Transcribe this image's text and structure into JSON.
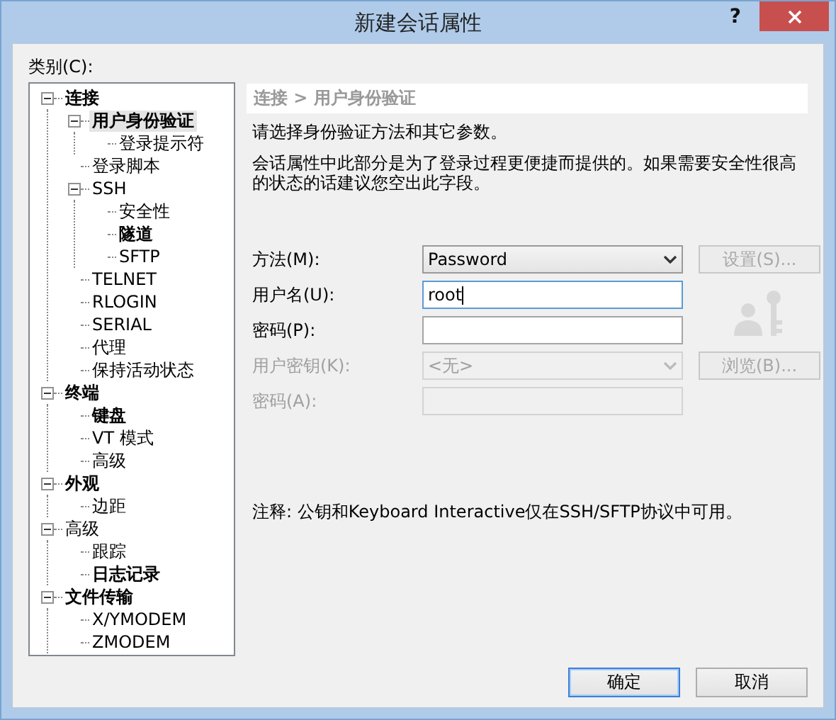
{
  "window": {
    "title": "新建会话属性",
    "help": "?"
  },
  "category_label": "类别(C):",
  "tree": [
    {
      "label": "连接",
      "bold": true,
      "selected": false,
      "expanded": true,
      "children": [
        {
          "label": "用户身份验证",
          "bold": true,
          "selected": true,
          "expanded": true,
          "children": [
            {
              "label": "登录提示符",
              "bold": false,
              "selected": false
            }
          ]
        },
        {
          "label": "登录脚本",
          "bold": false,
          "selected": false
        },
        {
          "label": "SSH",
          "bold": false,
          "selected": false,
          "expanded": true,
          "children": [
            {
              "label": "安全性",
              "bold": false,
              "selected": false
            },
            {
              "label": "隧道",
              "bold": true,
              "selected": false
            },
            {
              "label": "SFTP",
              "bold": false,
              "selected": false
            }
          ]
        },
        {
          "label": "TELNET",
          "bold": false,
          "selected": false
        },
        {
          "label": "RLOGIN",
          "bold": false,
          "selected": false
        },
        {
          "label": "SERIAL",
          "bold": false,
          "selected": false
        },
        {
          "label": "代理",
          "bold": false,
          "selected": false
        },
        {
          "label": "保持活动状态",
          "bold": false,
          "selected": false
        }
      ]
    },
    {
      "label": "终端",
      "bold": true,
      "selected": false,
      "expanded": true,
      "children": [
        {
          "label": "键盘",
          "bold": true,
          "selected": false
        },
        {
          "label": "VT 模式",
          "bold": false,
          "selected": false
        },
        {
          "label": "高级",
          "bold": false,
          "selected": false
        }
      ]
    },
    {
      "label": "外观",
      "bold": true,
      "selected": false,
      "expanded": true,
      "children": [
        {
          "label": "边距",
          "bold": false,
          "selected": false
        }
      ]
    },
    {
      "label": "高级",
      "bold": false,
      "selected": false,
      "expanded": true,
      "children": [
        {
          "label": "跟踪",
          "bold": false,
          "selected": false
        },
        {
          "label": "日志记录",
          "bold": true,
          "selected": false
        }
      ]
    },
    {
      "label": "文件传输",
      "bold": true,
      "selected": false,
      "expanded": true,
      "children": [
        {
          "label": "X/YMODEM",
          "bold": false,
          "selected": false
        },
        {
          "label": "ZMODEM",
          "bold": false,
          "selected": false
        }
      ]
    }
  ],
  "panel": {
    "breadcrumb": "连接 > 用户身份验证",
    "description": [
      "请选择身份验证方法和其它参数。",
      "会话属性中此部分是为了登录过程更便捷而提供的。如果需要安全性很高的状态的话建议您空出此字段。"
    ],
    "fields": [
      {
        "kind": "select",
        "label": "方法(M):",
        "value": "Password",
        "disabled": false,
        "focused": false,
        "button": {
          "label": "设置(S)...",
          "disabled": true
        }
      },
      {
        "kind": "text",
        "label": "用户名(U):",
        "value": "root",
        "disabled": false,
        "focused": true
      },
      {
        "kind": "password",
        "label": "密码(P):",
        "disabled": false,
        "focused": false
      },
      {
        "kind": "select",
        "label": "用户密钥(K):",
        "value": "<无>",
        "disabled": true,
        "focused": false,
        "button": {
          "label": "浏览(B)...",
          "disabled": true
        }
      },
      {
        "kind": "password",
        "label": "密码(A):",
        "disabled": true,
        "focused": false
      }
    ],
    "note": "注释: 公钥和Keyboard Interactive仅在SSH/SFTP协议中可用。"
  },
  "buttons": [
    {
      "label": "确定",
      "default": true
    },
    {
      "label": "取消",
      "default": false
    }
  ]
}
